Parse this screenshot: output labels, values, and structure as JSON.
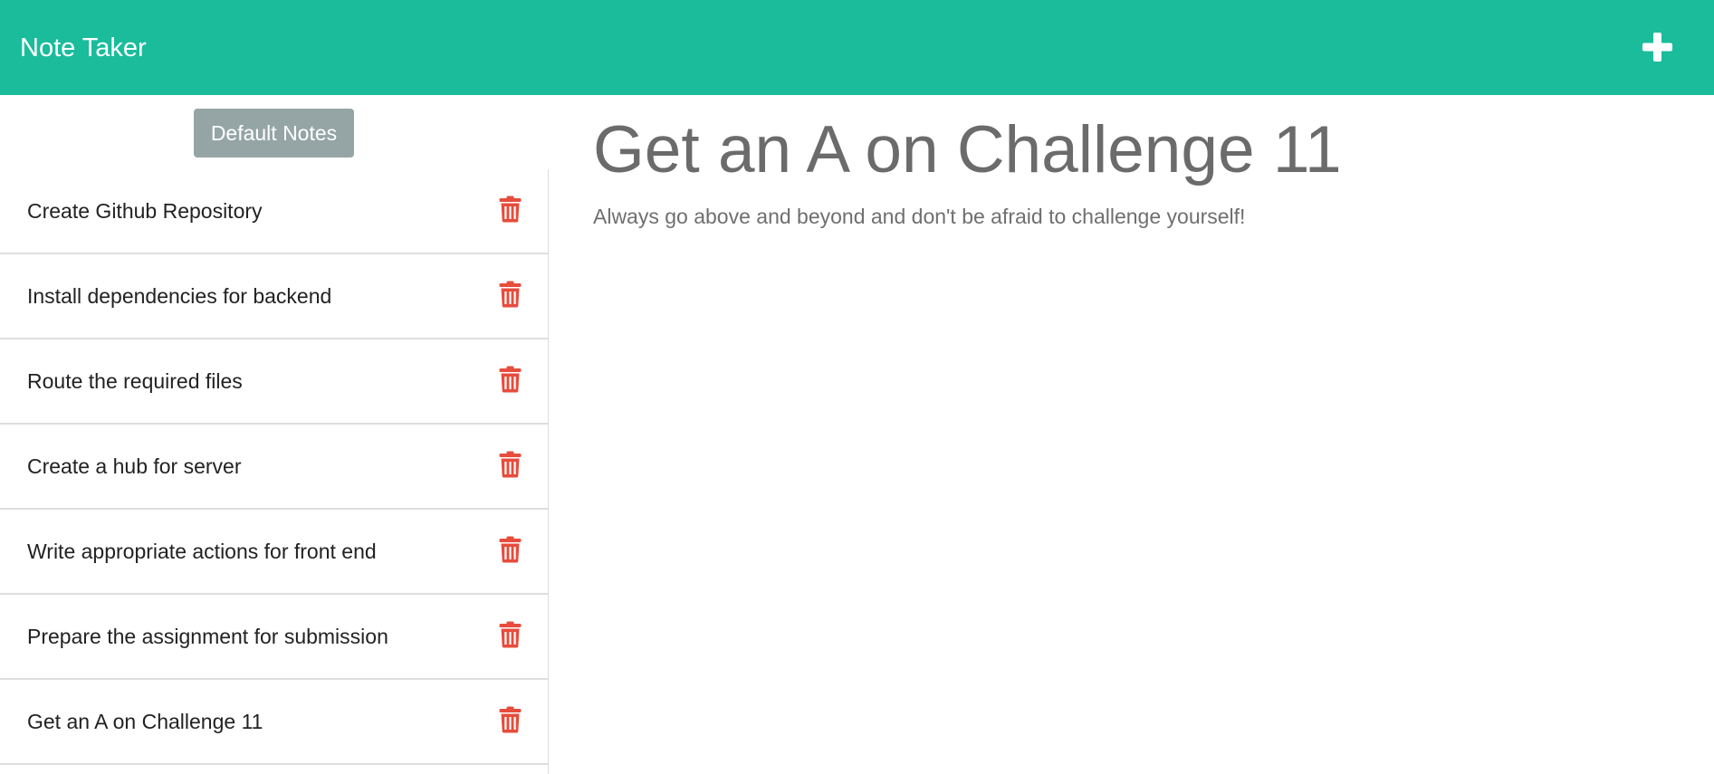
{
  "app": {
    "title": "Note Taker"
  },
  "header": {
    "add_icon": "plus-icon"
  },
  "sidebar": {
    "default_button_label": "Default Notes",
    "delete_icon": "trash-icon",
    "delete_color": "#e74c3c",
    "notes": [
      {
        "title": "Create Github Repository"
      },
      {
        "title": "Install dependencies for backend"
      },
      {
        "title": "Route the required files"
      },
      {
        "title": "Create a hub for server"
      },
      {
        "title": "Write appropriate actions for front end"
      },
      {
        "title": "Prepare the assignment for submission"
      },
      {
        "title": "Get an A on Challenge 11"
      }
    ]
  },
  "main": {
    "note_title": "Get an A on Challenge 11",
    "note_text": "Always go above and beyond and don't be afraid to challenge yourself!"
  },
  "colors": {
    "navbar": "#1abc9c",
    "default_button": "#95a5a6",
    "note_title": "#6b6b6b"
  }
}
